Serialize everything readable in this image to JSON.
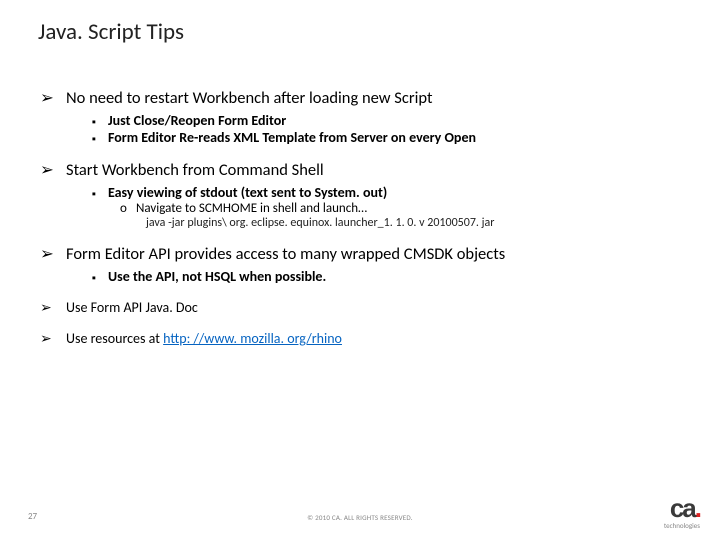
{
  "title": "Java. Script Tips",
  "bullets": {
    "b1": {
      "text": "No need to restart Workbench after loading new Script",
      "sub": [
        "Just Close/Reopen Form Editor",
        "Form Editor Re-reads XML Template from Server on every Open"
      ]
    },
    "b2": {
      "text": "Start Workbench from Command Shell",
      "sub": [
        "Easy viewing of stdout (text sent to System. out)"
      ],
      "subsub": {
        "text": "Navigate to SCMHOME in shell and launch…",
        "cmd": "java -jar plugins\\ org. eclipse. equinox. launcher_1. 1. 0. v 20100507. jar"
      }
    },
    "b3": {
      "text": "Form Editor API provides access to many wrapped CMSDK objects",
      "sub": [
        "Use the API, not HSQL when possible."
      ]
    },
    "b4": {
      "text": "Use Form API Java. Doc"
    },
    "b5": {
      "prefix": "Use resources at ",
      "link": "http: //www. mozilla. org/rhino"
    }
  },
  "footer": {
    "page": "27",
    "copyright": "© 2010 CA. ALL RIGHTS RESERVED."
  },
  "logo": {
    "brand": "ca",
    "sub": "technologies"
  }
}
